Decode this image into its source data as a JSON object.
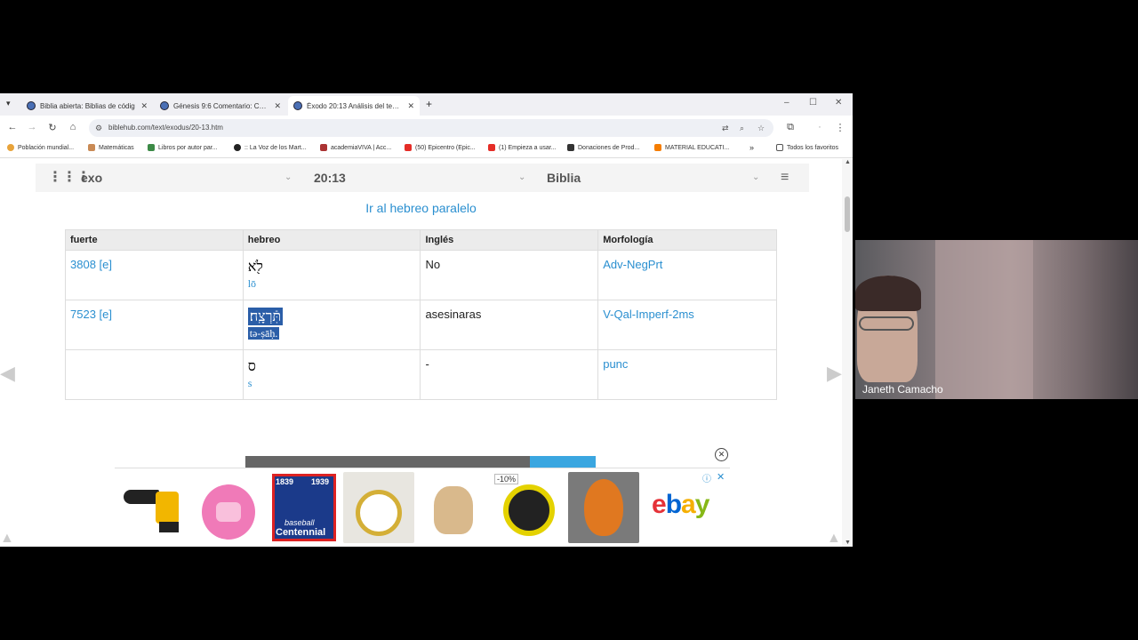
{
  "tabs": [
    {
      "title": "Biblia abierta: Biblias de códig"
    },
    {
      "title": "Génesis 9:6 Comentario: Cualq"
    },
    {
      "title": "Éxodo 20:13 Análisis del texto I"
    }
  ],
  "address": {
    "url": "biblehub.com/text/exodus/20-13.htm"
  },
  "bookmarks": [
    {
      "label": "Población mundial..."
    },
    {
      "label": "Matemáticas"
    },
    {
      "label": "Libros por autor par..."
    },
    {
      "label": ":: La Voz de los Mart..."
    },
    {
      "label": "academiaVIVA | Acc..."
    },
    {
      "label": "(50) Epicentro (Epic..."
    },
    {
      "label": "(1) Empieza a usar..."
    },
    {
      "label": "Donaciones de Prod..."
    },
    {
      "label": "MATERIAL EDUCATI..."
    },
    {
      "label": "Todos los favoritos"
    }
  ],
  "selector": {
    "book": "exo",
    "chapter": "20:13",
    "version": "Biblia"
  },
  "page": {
    "go_link": "Ir al hebreo paralelo"
  },
  "table": {
    "headers": [
      "fuerte",
      "hebreo",
      "Inglés",
      "Morfología"
    ],
    "rows": [
      {
        "strong": "3808 [e]",
        "hebrew": "לֹ֖א",
        "translit": "lō",
        "english": "No",
        "morph": "Adv-NegPrt"
      },
      {
        "strong": "7523 [e]",
        "hebrew": "תִּֿרְצָֽח׃",
        "translit": "tə-ṣāḥ.",
        "english": "asesinaras",
        "morph": "V-Qal-Imperf-2ms"
      },
      {
        "strong": "",
        "hebrew": "ס",
        "translit": "s",
        "english": "-",
        "morph": "punc"
      }
    ]
  },
  "ad": {
    "discount": "-10%",
    "brand": "ebay",
    "baseball_text_top": "1839",
    "baseball_text_year": "1939",
    "baseball_text": "Centennial",
    "baseball_sub": "baseball"
  },
  "video": {
    "participant": "Janeth Camacho"
  }
}
